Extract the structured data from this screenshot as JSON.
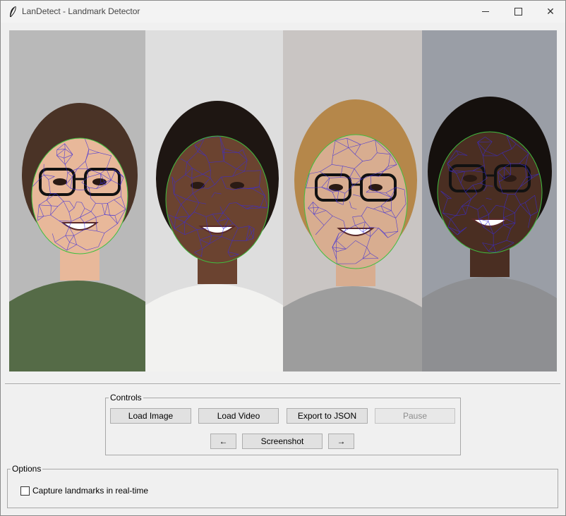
{
  "window": {
    "title": "LanDetect - Landmark Detector",
    "icon": "feather-icon",
    "minimize_glyph": "",
    "maximize_glyph": "",
    "close_glyph": "✕"
  },
  "canvas": {
    "description_colors": {
      "mesh": "#3a2bd9",
      "contour": "#3fbf3f"
    },
    "panels": [
      {
        "name": "face-panel-1",
        "bg": "#b9b9b9",
        "skin": "#e8b89a",
        "hair": "#4a3326",
        "shirt": "#556b47",
        "glasses": true
      },
      {
        "name": "face-panel-2",
        "bg": "#dedede",
        "skin": "#6b4330",
        "hair": "#1e1612",
        "shirt": "#f2f2f0",
        "glasses": false
      },
      {
        "name": "face-panel-3",
        "bg": "#c9c5c3",
        "skin": "#d8ad90",
        "hair": "#b5874a",
        "shirt": "#9d9d9d",
        "glasses": true
      },
      {
        "name": "face-panel-4",
        "bg": "#9a9ea6",
        "skin": "#4a2e22",
        "hair": "#15100d",
        "shirt": "#8e8f92",
        "glasses": true
      }
    ]
  },
  "controls": {
    "label": "Controls",
    "load_image": "Load Image",
    "load_video": "Load Video",
    "export_json": "Export to JSON",
    "pause": "Pause",
    "prev": "←",
    "screenshot": "Screenshot",
    "next": "→"
  },
  "options": {
    "label": "Options",
    "realtime_label": "Capture landmarks in real-time",
    "realtime_checked": false
  }
}
